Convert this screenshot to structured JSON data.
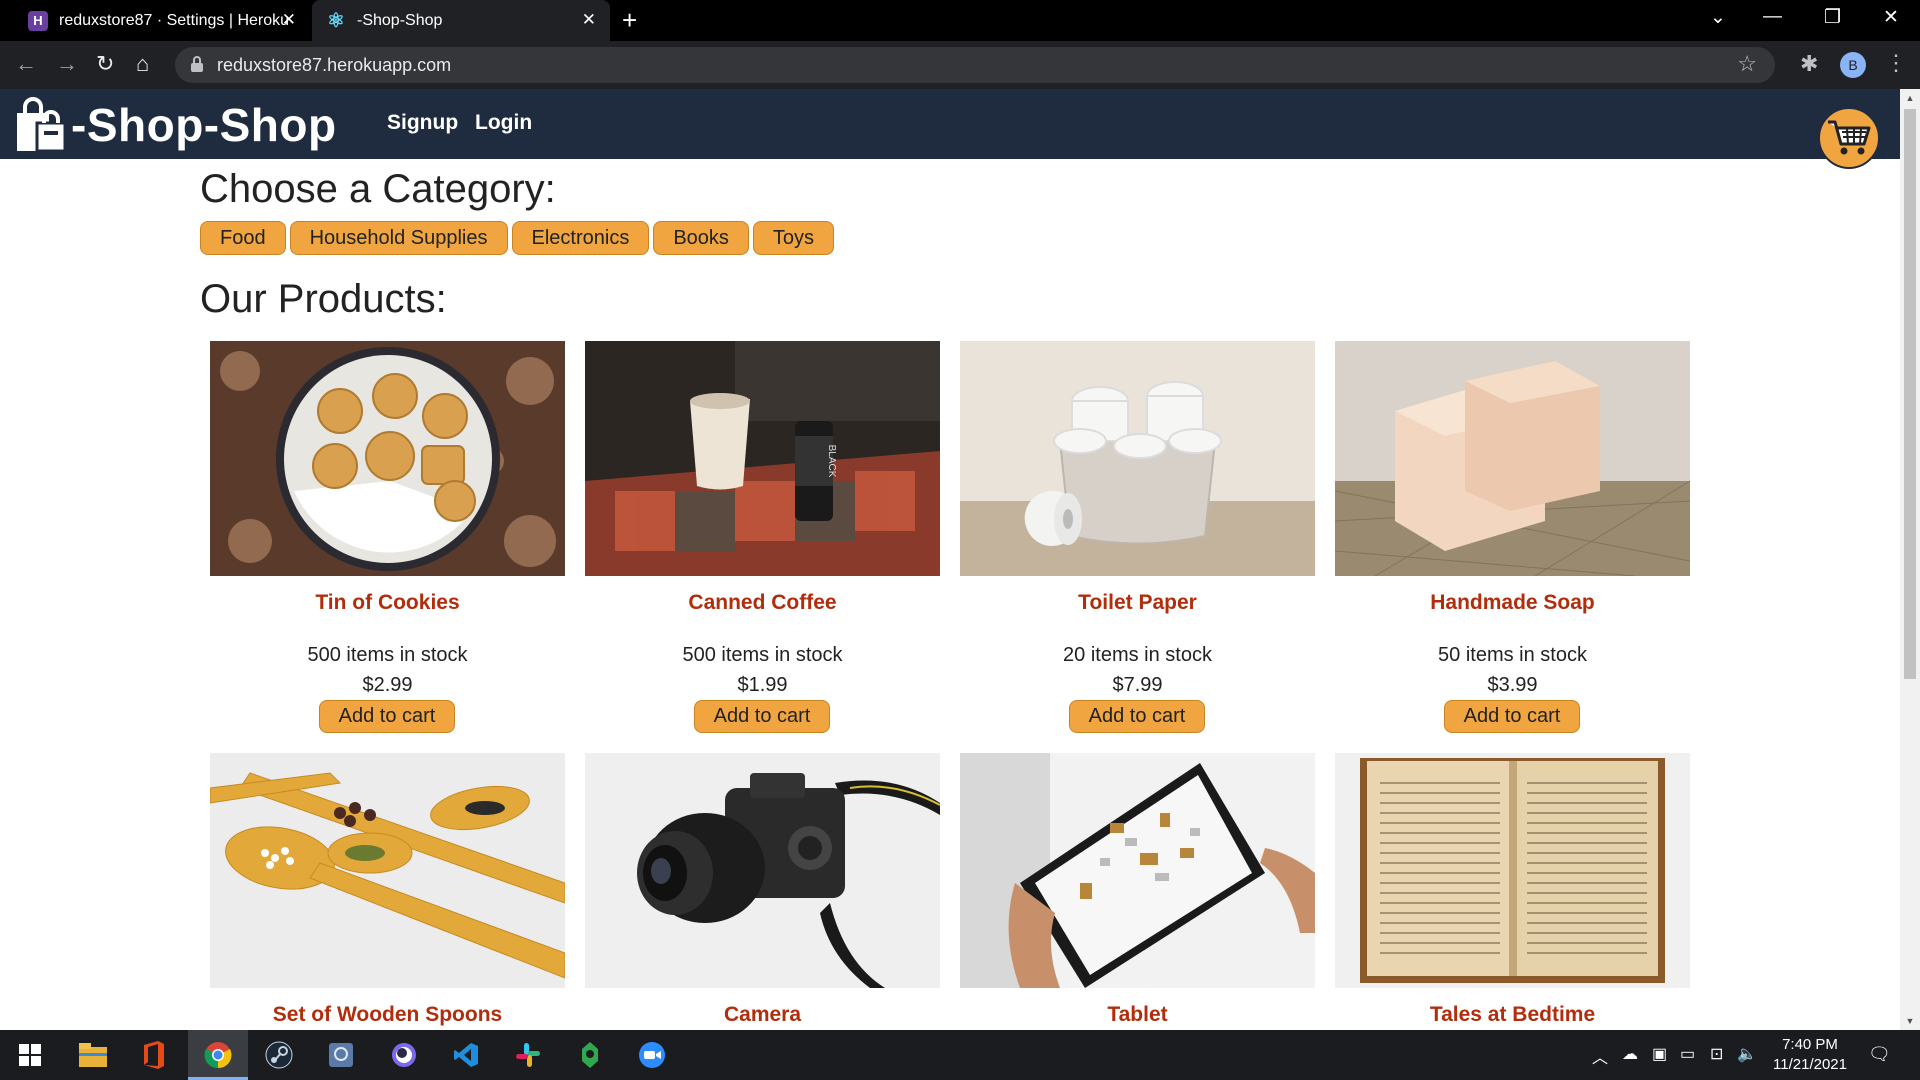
{
  "browser": {
    "tabs": [
      {
        "title": "reduxstore87 · Settings | Heroku",
        "favicon": "heroku-icon",
        "active": false
      },
      {
        "title": "-Shop-Shop",
        "favicon": "react-icon",
        "active": true
      }
    ],
    "url": "reduxstore87.herokuapp.com",
    "profile_initial": "B"
  },
  "app": {
    "brand": "-Shop-Shop",
    "nav": {
      "signup": "Signup",
      "login": "Login"
    },
    "category_heading": "Choose a Category:",
    "categories": [
      "Food",
      "Household Supplies",
      "Electronics",
      "Books",
      "Toys"
    ],
    "products_heading": "Our Products:",
    "add_label": "Add to cart",
    "products": [
      {
        "name": "Tin of Cookies",
        "stock": "500 items in stock",
        "price": "$2.99"
      },
      {
        "name": "Canned Coffee",
        "stock": "500 items in stock",
        "price": "$1.99"
      },
      {
        "name": "Toilet Paper",
        "stock": "20 items in stock",
        "price": "$7.99"
      },
      {
        "name": "Handmade Soap",
        "stock": "50 items in stock",
        "price": "$3.99"
      },
      {
        "name": "Set of Wooden Spoons"
      },
      {
        "name": "Camera"
      },
      {
        "name": "Tablet"
      },
      {
        "name": "Tales at Bedtime"
      }
    ]
  },
  "taskbar": {
    "time": "7:40 PM",
    "date": "11/21/2021"
  },
  "colors": {
    "header_bg": "#1f2b3e",
    "accent": "#f0a540",
    "product_name": "#b22d0c"
  }
}
